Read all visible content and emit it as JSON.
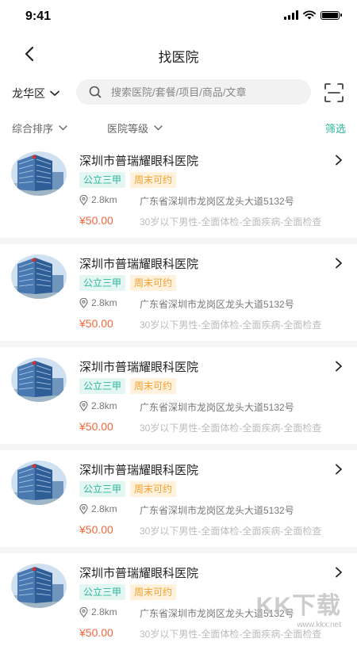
{
  "status_bar": {
    "time": "9:41"
  },
  "header": {
    "title": "找医院"
  },
  "search": {
    "district": "龙华区",
    "placeholder": "搜索医院/套餐/项目/商品/文章"
  },
  "filters": {
    "sort_label": "综合排序",
    "level_label": "医院等级",
    "filter_label": "筛选"
  },
  "hospitals": [
    {
      "name": "深圳市普瑞耀眼科医院",
      "tag_level": "公立三甲",
      "tag_weekend": "周末可约",
      "distance": "2.8km",
      "address": "广东省深圳市龙岗区龙头大道5132号",
      "price": "¥50.00",
      "package": "30岁以下男性-全面体检-全面疾病-全面检查"
    },
    {
      "name": "深圳市普瑞耀眼科医院",
      "tag_level": "公立三甲",
      "tag_weekend": "周末可约",
      "distance": "2.8km",
      "address": "广东省深圳市龙岗区龙头大道5132号",
      "price": "¥50.00",
      "package": "30岁以下男性-全面体检-全面疾病-全面检查"
    },
    {
      "name": "深圳市普瑞耀眼科医院",
      "tag_level": "公立三甲",
      "tag_weekend": "周末可约",
      "distance": "2.8km",
      "address": "广东省深圳市龙岗区龙头大道5132号",
      "price": "¥50.00",
      "package": "30岁以下男性-全面体检-全面疾病-全面检查"
    },
    {
      "name": "深圳市普瑞耀眼科医院",
      "tag_level": "公立三甲",
      "tag_weekend": "周末可约",
      "distance": "2.8km",
      "address": "广东省深圳市龙岗区龙头大道5132号",
      "price": "¥50.00",
      "package": "30岁以下男性-全面体检-全面疾病-全面检查"
    },
    {
      "name": "深圳市普瑞耀眼科医院",
      "tag_level": "公立三甲",
      "tag_weekend": "周末可约",
      "distance": "2.8km",
      "address": "广东省深圳市龙岗区龙头大道5132号",
      "price": "¥50.00",
      "package": "30岁以下男性-全面体检-全面疾病-全面检查"
    }
  ],
  "watermark": {
    "logo": "KK下载",
    "url": "www.kkx.net"
  },
  "colors": {
    "accent": "#2cb59a",
    "price": "#f2683c",
    "tag_orange": "#f0a030"
  }
}
